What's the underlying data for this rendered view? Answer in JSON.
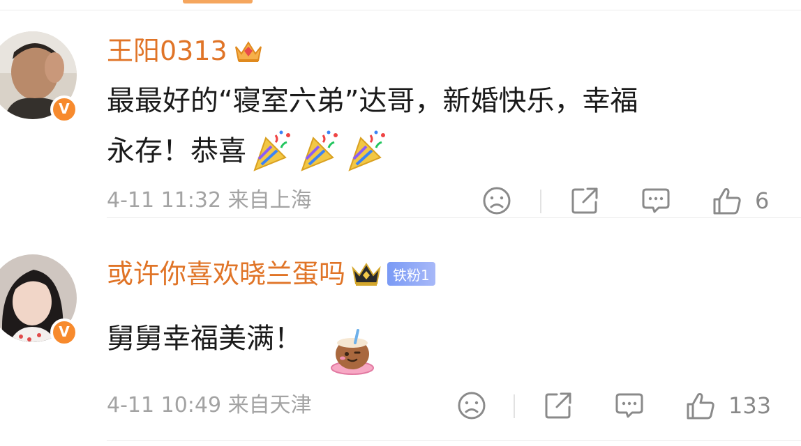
{
  "comments": [
    {
      "username": "王阳0313",
      "badge_icon": "crown-gem-icon",
      "verified_badge": "V",
      "text_line1": "最最好的“寝室六弟”达哥，新婚快乐，幸福",
      "text_line2": "永存！恭喜",
      "emojis": [
        "party-popper-icon",
        "party-popper-icon",
        "party-popper-icon"
      ],
      "meta": "4-11 11:32 来自上海",
      "like_count": "6"
    },
    {
      "username": "或许你喜欢晓兰蛋吗",
      "badge_icon": "black-crown-icon",
      "fan_badge": "铁粉1",
      "verified_badge": "V",
      "text_line1": "舅舅幸福美满！",
      "emojis": [
        "coconut-sticker-icon"
      ],
      "meta": "4-11 10:49 来自天津",
      "like_count": "133"
    }
  ],
  "colors": {
    "username": "#e07427",
    "meta": "#a3a3a3",
    "verified_badge": "#f78a2d",
    "fan_badge": "#8aa4f6"
  }
}
